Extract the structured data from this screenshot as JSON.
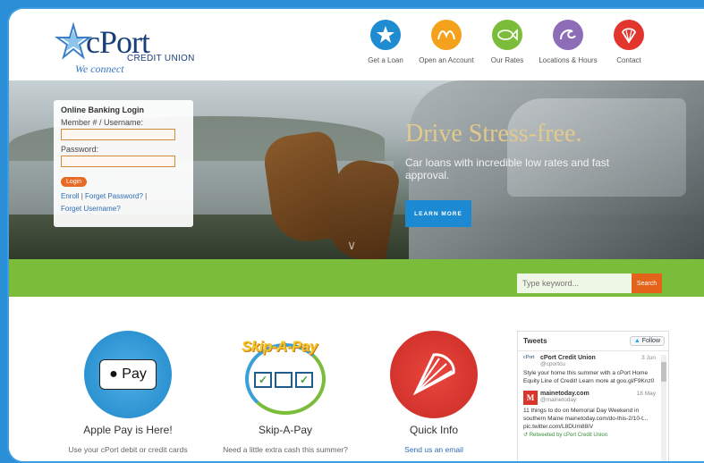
{
  "header": {
    "logo_name": "cPort",
    "logo_sub": "CREDIT UNION",
    "logo_tag": "We connect",
    "nav": [
      {
        "label": "Get a Loan",
        "icon": "starfish-icon",
        "color": "#1f8bd1"
      },
      {
        "label": "Open an Account",
        "icon": "shell-icon",
        "color": "#f4a11e"
      },
      {
        "label": "Our Rates",
        "icon": "fish-icon",
        "color": "#7bbd3b"
      },
      {
        "label": "Locations & Hours",
        "icon": "wave-icon",
        "color": "#8d6cb8"
      },
      {
        "label": "Contact",
        "icon": "scallop-icon",
        "color": "#e2352d"
      }
    ]
  },
  "login": {
    "title": "Online Banking Login",
    "member_label": "Member # / Username:",
    "password_label": "Password:",
    "button": "Login",
    "enroll": "Enroll",
    "forget_password": "Forget Password?",
    "forget_username": "Forget Username?"
  },
  "hero": {
    "title": "Drive Stress-free.",
    "text": "Car loans with incredible low rates and fast approval.",
    "button": "LEARN MORE"
  },
  "search": {
    "placeholder": "Type keyword...",
    "button": "Search"
  },
  "features": [
    {
      "title": "Apple Pay is Here!",
      "text": "Use your cPort debit or credit cards",
      "badge": "Pay"
    },
    {
      "title": "Skip-A-Pay",
      "text": "Need a little extra cash this summer?",
      "badge": "Skip-A-Pay"
    },
    {
      "title": "Quick Info",
      "link": "Send us an email"
    }
  ],
  "tweets": {
    "title": "Tweets",
    "follow": "Follow",
    "items": [
      {
        "avatar": "cPort",
        "name": "cPort Credit Union",
        "handle": "@cportcu",
        "date": "3 Jun",
        "text": "Style your home this summer with a cPort Home Equity Line of Credit! Learn more at goo.gl/F9Knz0"
      },
      {
        "avatar": "M",
        "name": "mainetoday.com",
        "handle": "@mainetoday",
        "date": "18 May",
        "text": "11 things to do on Memorial Day Weekend in southern Maine mainetoday.com/do-this-2/10-t... pic.twitter.com/L8DUm88iV",
        "retweet": "Retweeted by cPort Credit Union"
      }
    ]
  }
}
